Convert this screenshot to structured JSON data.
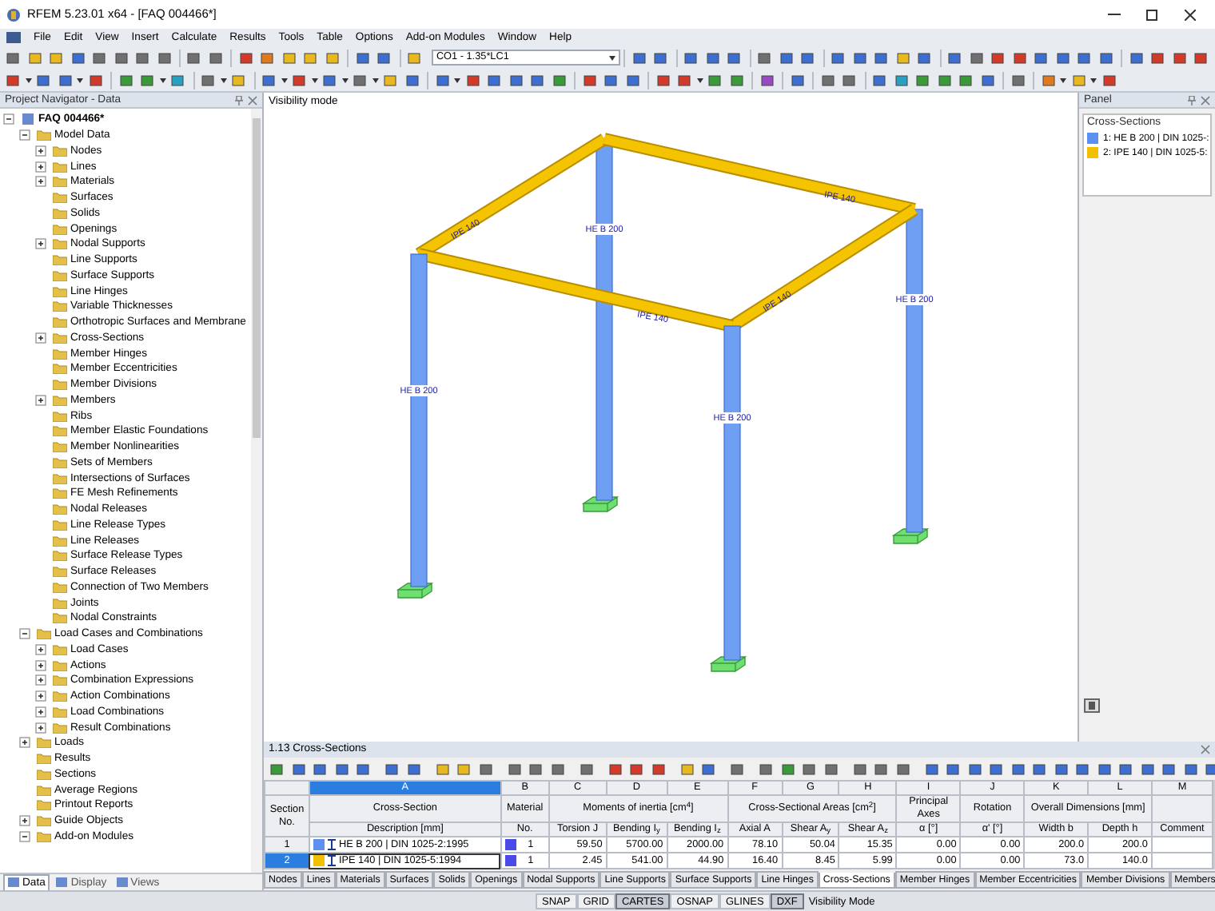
{
  "window": {
    "title": "RFEM 5.23.01 x64 - [FAQ 004466*]"
  },
  "menu": [
    "File",
    "Edit",
    "View",
    "Insert",
    "Calculate",
    "Results",
    "Tools",
    "Table",
    "Options",
    "Add-on Modules",
    "Window",
    "Help"
  ],
  "load_combo": {
    "value": "CO1 - 1.35*LC1"
  },
  "navigator": {
    "title": "Project Navigator - Data",
    "tree": [
      {
        "label": "FAQ 004466*",
        "expanded": true,
        "children": [
          {
            "label": "Model Data",
            "expanded": true,
            "children": [
              {
                "label": "Nodes",
                "expanded": false
              },
              {
                "label": "Lines",
                "expanded": false
              },
              {
                "label": "Materials",
                "expanded": false
              },
              {
                "label": "Surfaces"
              },
              {
                "label": "Solids"
              },
              {
                "label": "Openings"
              },
              {
                "label": "Nodal Supports",
                "expanded": false
              },
              {
                "label": "Line Supports"
              },
              {
                "label": "Surface Supports"
              },
              {
                "label": "Line Hinges"
              },
              {
                "label": "Variable Thicknesses"
              },
              {
                "label": "Orthotropic Surfaces and Membrane"
              },
              {
                "label": "Cross-Sections",
                "expanded": false
              },
              {
                "label": "Member Hinges"
              },
              {
                "label": "Member Eccentricities"
              },
              {
                "label": "Member Divisions"
              },
              {
                "label": "Members",
                "expanded": false
              },
              {
                "label": "Ribs"
              },
              {
                "label": "Member Elastic Foundations"
              },
              {
                "label": "Member Nonlinearities"
              },
              {
                "label": "Sets of Members"
              },
              {
                "label": "Intersections of Surfaces"
              },
              {
                "label": "FE Mesh Refinements"
              },
              {
                "label": "Nodal Releases"
              },
              {
                "label": "Line Release Types"
              },
              {
                "label": "Line Releases"
              },
              {
                "label": "Surface Release Types"
              },
              {
                "label": "Surface Releases"
              },
              {
                "label": "Connection of Two Members"
              },
              {
                "label": "Joints"
              },
              {
                "label": "Nodal Constraints"
              }
            ]
          },
          {
            "label": "Load Cases and Combinations",
            "expanded": true,
            "children": [
              {
                "label": "Load Cases",
                "expanded": false
              },
              {
                "label": "Actions",
                "expanded": false
              },
              {
                "label": "Combination Expressions",
                "expanded": false
              },
              {
                "label": "Action Combinations",
                "expanded": false
              },
              {
                "label": "Load Combinations",
                "expanded": false
              },
              {
                "label": "Result Combinations",
                "expanded": false
              }
            ]
          },
          {
            "label": "Loads",
            "expanded": false
          },
          {
            "label": "Results"
          },
          {
            "label": "Sections"
          },
          {
            "label": "Average Regions"
          },
          {
            "label": "Printout Reports"
          },
          {
            "label": "Guide Objects",
            "expanded": false
          },
          {
            "label": "Add-on Modules",
            "expanded": true
          }
        ]
      }
    ],
    "tabs": [
      {
        "label": "Data",
        "selected": true
      },
      {
        "label": "Display",
        "selected": false
      },
      {
        "label": "Views",
        "selected": false
      }
    ]
  },
  "viewport": {
    "mode_label": "Visibility mode",
    "member_labels": [
      "IPE 140",
      "IPE 140",
      "IPE 140",
      "IPE 140",
      "HE B 200",
      "HE B 200",
      "HE B 200",
      "HE B 200"
    ]
  },
  "panel": {
    "title": "Panel",
    "heading": "Cross-Sections",
    "items": [
      {
        "label": "1: HE B 200 | DIN 1025-:",
        "color": "#5b8ff0"
      },
      {
        "label": "2: IPE 140 | DIN 1025-5:",
        "color": "#f2c000"
      }
    ]
  },
  "cross_sections": {
    "title": "1.13 Cross-Sections",
    "letters": [
      "A",
      "B",
      "C",
      "D",
      "E",
      "F",
      "G",
      "H",
      "I",
      "J",
      "K",
      "L",
      "M"
    ],
    "first_header": "Section No.",
    "groups": [
      "Cross-Section",
      "Material",
      "Moments of inertia [cm$^{4}$]",
      "Cross-Sectional Areas [cm$^{2}$]",
      "Principal Axes",
      "Rotation",
      "Overall Dimensions [mm]"
    ],
    "subheaders": [
      "Description [mm]",
      "No.",
      "Torsion J",
      "Bending I$_{y}$",
      "Bending I$_{z}$",
      "Axial A",
      "Shear A$_{y}$",
      "Shear A$_{z}$",
      "α [°]",
      "α' [°]",
      "Width b",
      "Depth h",
      "Comment"
    ],
    "rows": [
      {
        "no": "1",
        "selected": false,
        "color": "#5b8ff0",
        "description": "HE B 200 | DIN 1025-2:1995",
        "material": "1",
        "values": [
          "59.50",
          "5700.00",
          "2000.00",
          "78.10",
          "50.04",
          "15.35",
          "0.00",
          "0.00",
          "200.0",
          "200.0"
        ]
      },
      {
        "no": "2",
        "selected": true,
        "color": "#f2c000",
        "description": "IPE 140 | DIN 1025-5:1994",
        "material": "1",
        "values": [
          "2.45",
          "541.00",
          "44.90",
          "16.40",
          "8.45",
          "5.99",
          "0.00",
          "0.00",
          "73.0",
          "140.0"
        ]
      }
    ],
    "tabs": [
      {
        "label": "Nodes",
        "selected": false
      },
      {
        "label": "Lines",
        "selected": false
      },
      {
        "label": "Materials",
        "selected": false
      },
      {
        "label": "Surfaces",
        "selected": false
      },
      {
        "label": "Solids",
        "selected": false
      },
      {
        "label": "Openings",
        "selected": false
      },
      {
        "label": "Nodal Supports",
        "selected": false
      },
      {
        "label": "Line Supports",
        "selected": false
      },
      {
        "label": "Surface Supports",
        "selected": false
      },
      {
        "label": "Line Hinges",
        "selected": false
      },
      {
        "label": "Cross-Sections",
        "selected": true
      },
      {
        "label": "Member Hinges",
        "selected": false
      },
      {
        "label": "Member Eccentricities",
        "selected": false
      },
      {
        "label": "Member Divisions",
        "selected": false
      },
      {
        "label": "Members",
        "selected": false
      }
    ]
  },
  "status_bar": {
    "toggles": [
      {
        "label": "SNAP",
        "on": false
      },
      {
        "label": "GRID",
        "on": false
      },
      {
        "label": "CARTES",
        "on": true
      },
      {
        "label": "OSNAP",
        "on": false
      },
      {
        "label": "GLINES",
        "on": false
      },
      {
        "label": "DXF",
        "on": true
      }
    ],
    "mode": "Visibility Mode"
  }
}
